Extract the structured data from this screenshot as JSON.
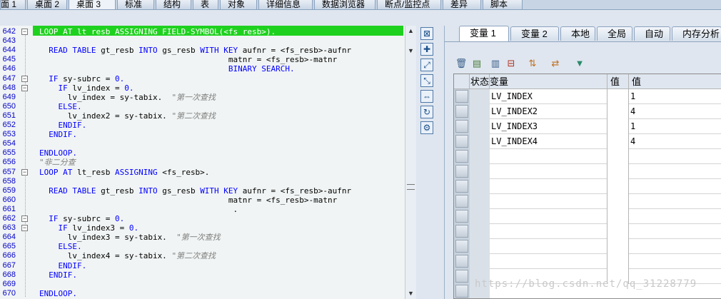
{
  "top_tabs": [
    "面 1",
    "桌面 2",
    "桌面 3",
    "标准",
    "结构",
    "表",
    "对象",
    "详细信息",
    "数据浏览器",
    "断点/监控点",
    "差异",
    "脚本"
  ],
  "code_lines": [
    {
      "num": "642",
      "fold": "⊟",
      "indent": 0,
      "parts": [
        {
          "t": "LOOP AT lt_resb ASSIGNING FIELD-SYMBOL(<fs_resb>).",
          "c": "kw"
        }
      ],
      "highlight": true
    },
    {
      "num": "643",
      "fold": "",
      "parts": []
    },
    {
      "num": "644",
      "fold": "",
      "parts": [
        {
          "t": "  READ TABLE ",
          "c": "kw"
        },
        {
          "t": "gt_resb ",
          "c": ""
        },
        {
          "t": "INTO ",
          "c": "kw"
        },
        {
          "t": "gs_resb ",
          "c": ""
        },
        {
          "t": "WITH KEY ",
          "c": "kw"
        },
        {
          "t": "aufnr = <fs_resb>-aufnr",
          "c": ""
        }
      ]
    },
    {
      "num": "645",
      "fold": "",
      "parts": [
        {
          "t": "                                        matnr = <fs_resb>-matnr",
          "c": ""
        }
      ]
    },
    {
      "num": "646",
      "fold": "",
      "parts": [
        {
          "t": "                                        BINARY SEARCH.",
          "c": "kw"
        }
      ]
    },
    {
      "num": "647",
      "fold": "⊟",
      "parts": [
        {
          "t": "  IF ",
          "c": "kw"
        },
        {
          "t": "sy-subrc = ",
          "c": ""
        },
        {
          "t": "0.",
          "c": "kw"
        }
      ]
    },
    {
      "num": "648",
      "fold": "⊟",
      "parts": [
        {
          "t": "    IF ",
          "c": "kw"
        },
        {
          "t": "lv_index = ",
          "c": ""
        },
        {
          "t": "0.",
          "c": "kw"
        }
      ]
    },
    {
      "num": "649",
      "fold": "",
      "parts": [
        {
          "t": "      lv_index = sy-tabix.  ",
          "c": ""
        },
        {
          "t": "\"第一次查找",
          "c": "com"
        }
      ]
    },
    {
      "num": "650",
      "fold": "",
      "parts": [
        {
          "t": "    ELSE.",
          "c": "kw"
        }
      ]
    },
    {
      "num": "651",
      "fold": "",
      "parts": [
        {
          "t": "      lv_index2 = sy-tabix. ",
          "c": ""
        },
        {
          "t": "\"第二次查找",
          "c": "com"
        }
      ]
    },
    {
      "num": "652",
      "fold": "",
      "parts": [
        {
          "t": "    ENDIF.",
          "c": "kw"
        }
      ]
    },
    {
      "num": "653",
      "fold": "",
      "parts": [
        {
          "t": "  ENDIF.",
          "c": "kw"
        }
      ]
    },
    {
      "num": "654",
      "fold": "",
      "parts": []
    },
    {
      "num": "655",
      "fold": "",
      "parts": [
        {
          "t": "ENDLOOP.",
          "c": "kw"
        }
      ]
    },
    {
      "num": "656",
      "fold": "",
      "parts": [
        {
          "t": "\"非二分查",
          "c": "com"
        }
      ]
    },
    {
      "num": "657",
      "fold": "⊟",
      "parts": [
        {
          "t": "LOOP AT ",
          "c": "kw"
        },
        {
          "t": "lt_resb ",
          "c": ""
        },
        {
          "t": "ASSIGNING ",
          "c": "kw"
        },
        {
          "t": "<fs_resb>.",
          "c": ""
        }
      ]
    },
    {
      "num": "658",
      "fold": "",
      "parts": []
    },
    {
      "num": "659",
      "fold": "",
      "parts": [
        {
          "t": "  READ TABLE ",
          "c": "kw"
        },
        {
          "t": "gt_resb ",
          "c": ""
        },
        {
          "t": "INTO ",
          "c": "kw"
        },
        {
          "t": "gs_resb ",
          "c": ""
        },
        {
          "t": "WITH KEY ",
          "c": "kw"
        },
        {
          "t": "aufnr = <fs_resb>-aufnr",
          "c": ""
        }
      ]
    },
    {
      "num": "660",
      "fold": "",
      "parts": [
        {
          "t": "                                        matnr = <fs_resb>-matnr",
          "c": ""
        }
      ]
    },
    {
      "num": "661",
      "fold": "",
      "parts": [
        {
          "t": "                                         .",
          "c": ""
        }
      ]
    },
    {
      "num": "662",
      "fold": "⊟",
      "parts": [
        {
          "t": "  IF ",
          "c": "kw"
        },
        {
          "t": "sy-subrc = ",
          "c": ""
        },
        {
          "t": "0.",
          "c": "kw"
        }
      ]
    },
    {
      "num": "663",
      "fold": "⊟",
      "parts": [
        {
          "t": "    IF ",
          "c": "kw"
        },
        {
          "t": "lv_index3 = ",
          "c": ""
        },
        {
          "t": "0.",
          "c": "kw"
        }
      ]
    },
    {
      "num": "664",
      "fold": "",
      "parts": [
        {
          "t": "      lv_index3 = sy-tabix.  ",
          "c": ""
        },
        {
          "t": "\"第一次查找",
          "c": "com"
        }
      ]
    },
    {
      "num": "665",
      "fold": "",
      "parts": [
        {
          "t": "    ELSE.",
          "c": "kw"
        }
      ]
    },
    {
      "num": "666",
      "fold": "",
      "parts": [
        {
          "t": "      lv_index4 = sy-tabix. ",
          "c": ""
        },
        {
          "t": "\"第二次查找",
          "c": "com"
        }
      ]
    },
    {
      "num": "667",
      "fold": "",
      "parts": [
        {
          "t": "    ENDIF.",
          "c": "kw"
        }
      ]
    },
    {
      "num": "668",
      "fold": "",
      "parts": [
        {
          "t": "  ENDIF.",
          "c": "kw"
        }
      ]
    },
    {
      "num": "669",
      "fold": "",
      "parts": []
    },
    {
      "num": "670",
      "fold": "",
      "parts": [
        {
          "t": "ENDLOOP.",
          "c": "kw"
        }
      ]
    }
  ],
  "tool_icons": [
    "close-icon",
    "new-item-icon",
    "fullscreen-icon",
    "resize-icon",
    "split-icon",
    "refresh-icon",
    "settings-icon"
  ],
  "var_tabs": [
    "变量 1",
    "变量 2",
    "本地",
    "全局",
    "自动",
    "内存分析"
  ],
  "panel_tools": [
    "delete-icon",
    "detail-icon",
    "edit-icon",
    "remove-icon",
    "sort-icon",
    "transfer-icon",
    "filter-icon"
  ],
  "grid": {
    "headers": {
      "status": "状态",
      "variable": "变量",
      "type": "值",
      "value": "值"
    },
    "rows": [
      {
        "variable": "LV_INDEX",
        "value": "1"
      },
      {
        "variable": "LV_INDEX2",
        "value": "4"
      },
      {
        "variable": "LV_INDEX3",
        "value": "1"
      },
      {
        "variable": "LV_INDEX4",
        "value": "4"
      }
    ]
  },
  "watermark": "https://blog.csdn.net/qq_31228779"
}
